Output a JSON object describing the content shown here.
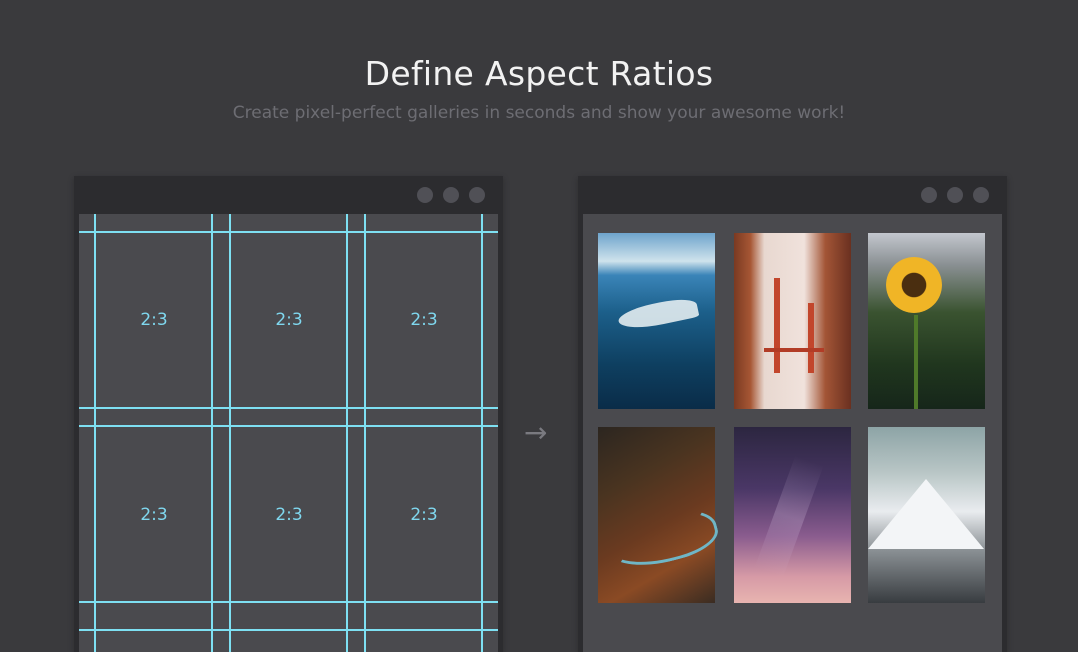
{
  "header": {
    "title": "Define Aspect Ratios",
    "subtitle": "Create pixel-perfect galleries in seconds and show your awesome work!"
  },
  "grid_window": {
    "cells": [
      {
        "label": "2:3"
      },
      {
        "label": "2:3"
      },
      {
        "label": "2:3"
      },
      {
        "label": "2:3"
      },
      {
        "label": "2:3"
      },
      {
        "label": "2:3"
      }
    ]
  },
  "arrow": {
    "icon": "arrow-right-icon",
    "glyph": "→"
  },
  "gallery_window": {
    "photos": [
      {
        "subject": "ocean-wave"
      },
      {
        "subject": "golden-gate-bridge"
      },
      {
        "subject": "sunflower"
      },
      {
        "subject": "winding-river"
      },
      {
        "subject": "milky-way-sky"
      },
      {
        "subject": "snowy-mountains"
      }
    ]
  },
  "colors": {
    "background": "#3a3a3d",
    "window": "#2c2c2f",
    "panel": "#4a4a4e",
    "guide": "#7ee0f2",
    "label": "#7fd7ee"
  }
}
